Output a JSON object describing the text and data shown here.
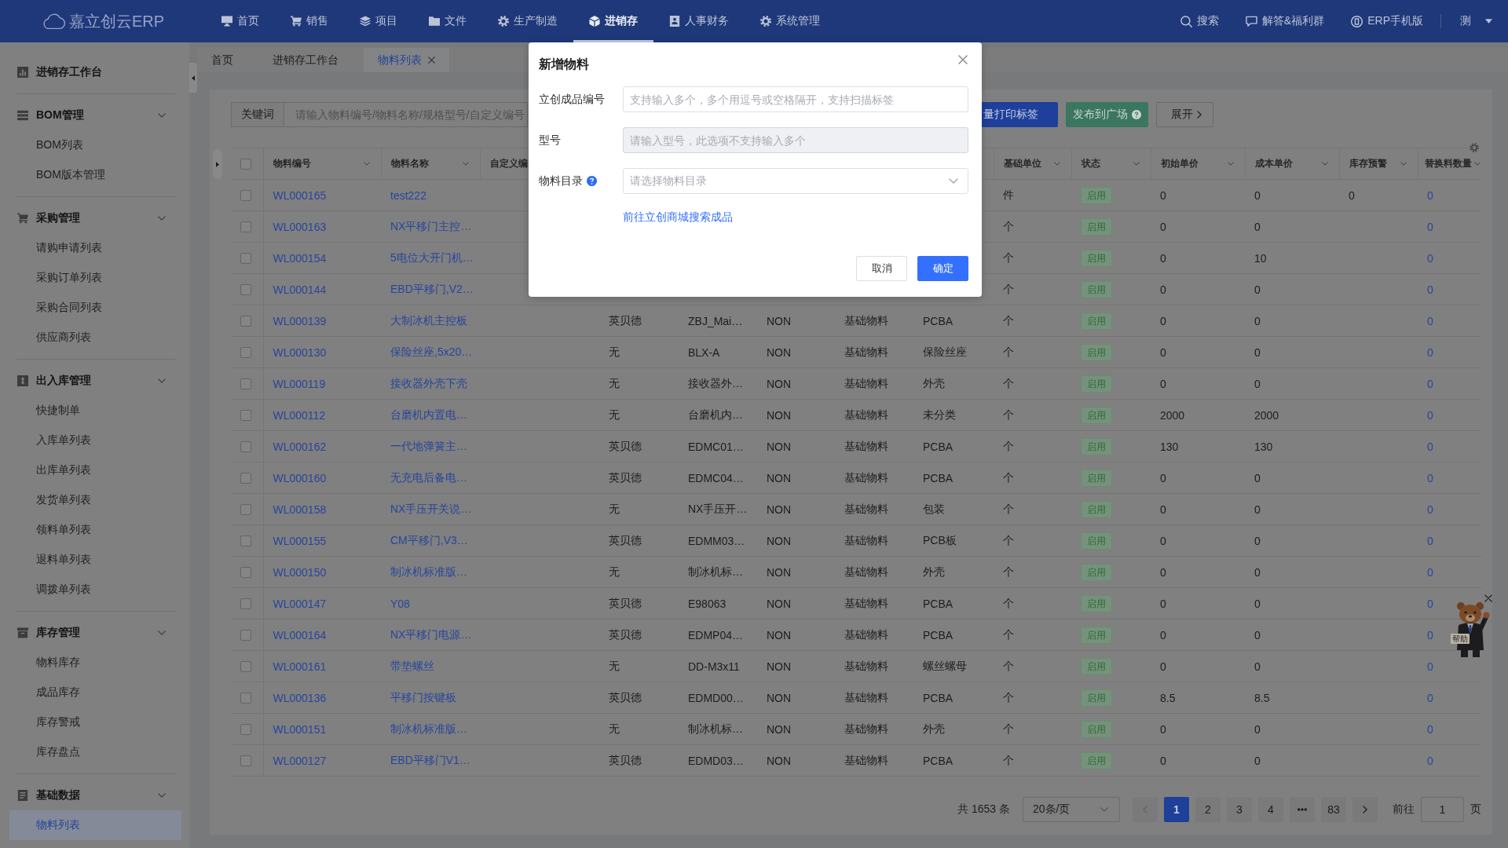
{
  "header": {
    "logo": "嘉立创云ERP",
    "nav": [
      {
        "label": "首页",
        "selected": false
      },
      {
        "label": "销售",
        "selected": false
      },
      {
        "label": "项目",
        "selected": false
      },
      {
        "label": "文件",
        "selected": false
      },
      {
        "label": "生产制造",
        "selected": false
      },
      {
        "label": "进销存",
        "selected": true
      },
      {
        "label": "人事财务",
        "selected": false
      },
      {
        "label": "系统管理",
        "selected": false
      }
    ],
    "tools": [
      {
        "label": "搜索"
      },
      {
        "label": "解答&福利群"
      },
      {
        "label": "ERP手机版"
      }
    ],
    "user": "测"
  },
  "sidebar": {
    "sections": [
      {
        "kind": "link",
        "label": "进销存工作台",
        "selected": false
      },
      {
        "kind": "group",
        "label": "BOM管理",
        "expanded": true,
        "items": [
          {
            "label": "BOM列表",
            "selected": false
          },
          {
            "label": "BOM版本管理",
            "selected": false
          }
        ]
      },
      {
        "kind": "group",
        "label": "采购管理",
        "expanded": true,
        "items": [
          {
            "label": "请购申请列表",
            "selected": false
          },
          {
            "label": "采购订单列表",
            "selected": false
          },
          {
            "label": "采购合同列表",
            "selected": false
          },
          {
            "label": "供应商列表",
            "selected": false
          }
        ]
      },
      {
        "kind": "group",
        "label": "出入库管理",
        "expanded": true,
        "items": [
          {
            "label": "快捷制单",
            "selected": false
          },
          {
            "label": "入库单列表",
            "selected": false
          },
          {
            "label": "出库单列表",
            "selected": false
          },
          {
            "label": "发货单列表",
            "selected": false
          },
          {
            "label": "领料单列表",
            "selected": false
          },
          {
            "label": "退料单列表",
            "selected": false
          },
          {
            "label": "调拨单列表",
            "selected": false
          }
        ]
      },
      {
        "kind": "group",
        "label": "库存管理",
        "expanded": true,
        "items": [
          {
            "label": "物料库存",
            "selected": false
          },
          {
            "label": "成品库存",
            "selected": false
          },
          {
            "label": "库存警戒",
            "selected": false
          },
          {
            "label": "库存盘点",
            "selected": false
          }
        ]
      },
      {
        "kind": "group",
        "label": "基础数据",
        "expanded": true,
        "items": [
          {
            "label": "物料列表",
            "selected": true
          }
        ]
      }
    ]
  },
  "tabs": [
    {
      "label": "首页",
      "selected": false
    },
    {
      "label": "进销存工作台",
      "selected": false
    },
    {
      "label": "物料列表",
      "selected": true
    }
  ],
  "filter": {
    "label": "关键词",
    "placeholder": "请输入物料编号/物料名称/规格型号/自定义编号"
  },
  "actions": [
    {
      "label": "量打印标签",
      "kind": "primary"
    },
    {
      "label": "发布到广场",
      "kind": "success"
    },
    {
      "label": "展开",
      "kind": "plain"
    }
  ],
  "table": {
    "all_checked": false,
    "columns": [
      {
        "label": "物料编号"
      },
      {
        "label": "物料名称"
      },
      {
        "label": "自定义编"
      },
      {
        "label": "基础单位"
      },
      {
        "label": "状态"
      },
      {
        "label": "初始单价"
      },
      {
        "label": "成本单价"
      },
      {
        "label": "库存预警"
      },
      {
        "label": "替换料数量"
      }
    ],
    "rows": [
      {
        "checked": false,
        "code": "WL000165",
        "name": "test222",
        "unit": "件",
        "status": "启用",
        "initial_price": "0",
        "cost_price": "0",
        "stock_alert": "0",
        "replacement_count": "0"
      },
      {
        "checked": false,
        "code": "WL000163",
        "name": "NX平移门主控…",
        "unit": "个",
        "status": "启用",
        "initial_price": "0",
        "cost_price": "0",
        "replacement_count": "0"
      },
      {
        "checked": false,
        "code": "WL000154",
        "name": "5电位大开门机…",
        "unit": "个",
        "status": "启用",
        "initial_price": "0",
        "cost_price": "10",
        "replacement_count": "0"
      },
      {
        "checked": false,
        "code": "WL000144",
        "name": "EBD平移门,V2…",
        "unit": "个",
        "status": "启用",
        "initial_price": "0",
        "cost_price": "0",
        "replacement_count": "0"
      },
      {
        "checked": false,
        "code": "WL000139",
        "name": "大制冰机主控板",
        "column_4": "英贝德",
        "column_5": "ZBJ_Mai…",
        "column_6": "NON",
        "column_7": "基础物料",
        "column_8": "PCBA",
        "unit": "个",
        "status": "启用",
        "initial_price": "0",
        "cost_price": "0",
        "replacement_count": "0"
      },
      {
        "checked": false,
        "code": "WL000130",
        "name": "保险丝座,5x20…",
        "column_4": "无",
        "column_5": "BLX-A",
        "column_6": "NON",
        "column_7": "基础物料",
        "column_8": "保险丝座",
        "unit": "个",
        "status": "启用",
        "initial_price": "0",
        "cost_price": "0",
        "replacement_count": "0"
      },
      {
        "checked": false,
        "code": "WL000119",
        "name": "接收器外壳下壳",
        "column_4": "无",
        "column_5": "接收器外…",
        "column_6": "NON",
        "column_7": "基础物料",
        "column_8": "外壳",
        "unit": "个",
        "status": "启用",
        "initial_price": "0",
        "cost_price": "0",
        "replacement_count": "0"
      },
      {
        "checked": false,
        "code": "WL000112",
        "name": "台磨机内置电…",
        "column_4": "无",
        "column_5": "台磨机内…",
        "column_6": "NON",
        "column_7": "基础物料",
        "column_8": "未分类",
        "unit": "个",
        "status": "启用",
        "initial_price": "2000",
        "cost_price": "2000",
        "replacement_count": "0"
      },
      {
        "checked": false,
        "code": "WL000162",
        "name": "一代地弹簧主…",
        "column_4": "英贝德",
        "column_5": "EDMC01…",
        "column_6": "NON",
        "column_7": "基础物料",
        "column_8": "PCBA",
        "unit": "个",
        "status": "启用",
        "initial_price": "130",
        "cost_price": "130",
        "replacement_count": "0"
      },
      {
        "checked": false,
        "code": "WL000160",
        "name": "无充电后备电…",
        "column_4": "英贝德",
        "column_5": "EDMC04…",
        "column_6": "NON",
        "column_7": "基础物料",
        "column_8": "PCBA",
        "unit": "个",
        "status": "启用",
        "initial_price": "0",
        "cost_price": "0",
        "replacement_count": "0"
      },
      {
        "checked": false,
        "code": "WL000158",
        "name": "NX手压开关说…",
        "column_4": "无",
        "column_5": "NX手压开…",
        "column_6": "NON",
        "column_7": "基础物料",
        "column_8": "包装",
        "unit": "个",
        "status": "启用",
        "initial_price": "0",
        "cost_price": "0",
        "replacement_count": "0"
      },
      {
        "checked": false,
        "code": "WL000155",
        "name": "CM平移门,V3…",
        "column_4": "英贝德",
        "column_5": "EDMM03…",
        "column_6": "NON",
        "column_7": "基础物料",
        "column_8": "PCB板",
        "unit": "个",
        "status": "启用",
        "initial_price": "0",
        "cost_price": "0",
        "replacement_count": "0"
      },
      {
        "checked": false,
        "code": "WL000150",
        "name": "制冰机标准版…",
        "column_4": "无",
        "column_5": "制冰机标…",
        "column_6": "NON",
        "column_7": "基础物料",
        "column_8": "外壳",
        "unit": "个",
        "status": "启用",
        "initial_price": "0",
        "cost_price": "0",
        "replacement_count": "0"
      },
      {
        "checked": false,
        "code": "WL000147",
        "name": "Y08",
        "column_4": "英贝德",
        "column_5": "E98063",
        "column_6": "NON",
        "column_7": "基础物料",
        "column_8": "PCBA",
        "unit": "个",
        "status": "启用",
        "initial_price": "0",
        "cost_price": "0",
        "replacement_count": "0"
      },
      {
        "checked": false,
        "code": "WL000164",
        "name": "NX平移门电源…",
        "column_4": "英贝德",
        "column_5": "EDMP04…",
        "column_6": "NON",
        "column_7": "基础物料",
        "column_8": "PCBA",
        "unit": "个",
        "status": "启用",
        "initial_price": "0",
        "cost_price": "0",
        "replacement_count": "0"
      },
      {
        "checked": false,
        "code": "WL000161",
        "name": "带垫螺丝",
        "column_4": "无",
        "column_5": "DD-M3x11",
        "column_6": "NON",
        "column_7": "基础物料",
        "column_8": "螺丝螺母",
        "unit": "个",
        "status": "启用",
        "initial_price": "0",
        "cost_price": "0",
        "replacement_count": "0"
      },
      {
        "checked": false,
        "code": "WL000136",
        "name": "平移门按键板",
        "column_4": "英贝德",
        "column_5": "EDMD00…",
        "column_6": "NON",
        "column_7": "基础物料",
        "column_8": "PCBA",
        "unit": "个",
        "status": "启用",
        "initial_price": "8.5",
        "cost_price": "8.5",
        "replacement_count": "0"
      },
      {
        "checked": false,
        "code": "WL000151",
        "name": "制冰机标准版…",
        "column_4": "无",
        "column_5": "制冰机标…",
        "column_6": "NON",
        "column_7": "基础物料",
        "column_8": "外壳",
        "unit": "个",
        "status": "启用",
        "initial_price": "0",
        "cost_price": "0",
        "replacement_count": "0"
      },
      {
        "checked": false,
        "code": "WL000127",
        "name": "EBD平移门V1…",
        "column_4": "英贝德",
        "column_5": "EDMD03…",
        "column_6": "NON",
        "column_7": "基础物料",
        "column_8": "PCBA",
        "unit": "个",
        "status": "启用",
        "initial_price": "0",
        "cost_price": "0",
        "replacement_count": "0"
      }
    ]
  },
  "pagination": {
    "total": "共 1653 条",
    "page_size": "20条/页",
    "prev_disabled": true,
    "pages": [
      {
        "kind": "page",
        "label": "1",
        "selected": true
      },
      {
        "kind": "page",
        "label": "2",
        "selected": false
      },
      {
        "kind": "page",
        "label": "3",
        "selected": false
      },
      {
        "kind": "page",
        "label": "4",
        "selected": false
      },
      {
        "kind": "more",
        "selected": false
      },
      {
        "kind": "page",
        "label": "83",
        "selected": false
      }
    ],
    "next_disabled": false,
    "goto_label": "前往",
    "goto_value": "1",
    "goto_suffix": "页"
  },
  "helper": {
    "label": "帮助"
  },
  "modal": {
    "title": "新增物料",
    "fields": [
      {
        "kind": "input",
        "label": "立创成品编号",
        "placeholder": "支持输入多个，多个用逗号或空格隔开，支持扫描标签",
        "disabled": false
      },
      {
        "kind": "input",
        "label": "型号",
        "placeholder": "请输入型号，此选项不支持输入多个",
        "disabled": true
      },
      {
        "kind": "select",
        "label": "物料目录",
        "placeholder": "请选择物料目录",
        "disabled": false
      }
    ],
    "link": "前往立创商城搜索成品",
    "buttons": [
      {
        "kind": "default",
        "label": "取消"
      },
      {
        "kind": "primary",
        "label": "确定"
      }
    ]
  }
}
